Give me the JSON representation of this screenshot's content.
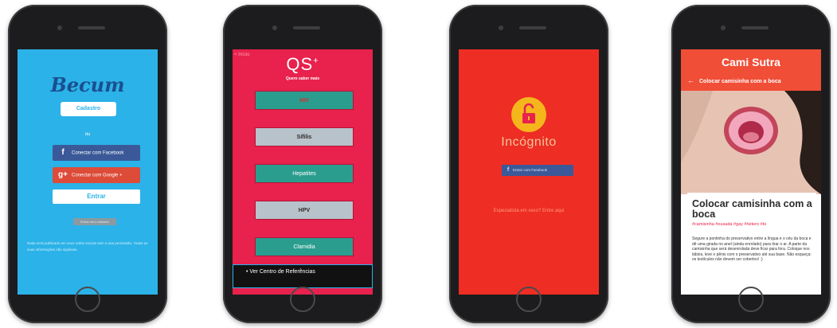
{
  "screen1": {
    "logo": "Becum",
    "cadastro": "Cadastro",
    "ou": "ou",
    "facebook_label": "Conectar com Facebook",
    "facebook_icon": "f",
    "google_label": "Conectar com Google +",
    "google_icon": "g+",
    "entrar": "Entrar",
    "small_button": "Entrar sem cadastro",
    "note": "Nada será publicado em seus redes sociais sem a sua permissão. Todas as suas informações são sigilosas."
  },
  "screen2": {
    "back": "< Início",
    "logo_main": "QS",
    "logo_sup": "+",
    "subtitle": "Quero saber mais",
    "items": [
      {
        "label": "HIV"
      },
      {
        "label": "Sífilis"
      },
      {
        "label": "Hepatites"
      },
      {
        "label": "HPV"
      },
      {
        "label": "Clamidia"
      }
    ],
    "reference": "Ver Centro de Referências"
  },
  "screen3": {
    "title": "Incógnito",
    "facebook_label": "Entrar com Facebook",
    "facebook_icon": "f",
    "expert": "Especialista em sexo? Entre aqui"
  },
  "screen4": {
    "app_title": "Cami Sutra",
    "nav_title": "Colocar camisinha com a boca",
    "nav_arrow": "←",
    "heading": "Colocar camisinha com a boca",
    "tags": "#camisinha #ousada #gay #hétero #bi",
    "body": "Segure a pontinha do preservativo entre a língua e o céu da boca e dê uma girada no anel (ainda enrolado) para tirar o ar. A parte da camisinha que será desenrolada deve ficar para fora. Coloque nos lábios, leve o pênis com o preservativo até sua base. Não esqueça: os testículos não devem ser cobertos! ;)"
  },
  "colors": {
    "becum_blue": "#2bb2e8",
    "qs_pink": "#e8214d",
    "incognito_red": "#ee2d24",
    "camisutra_red": "#f04e37",
    "teal": "#2a9d8f"
  }
}
